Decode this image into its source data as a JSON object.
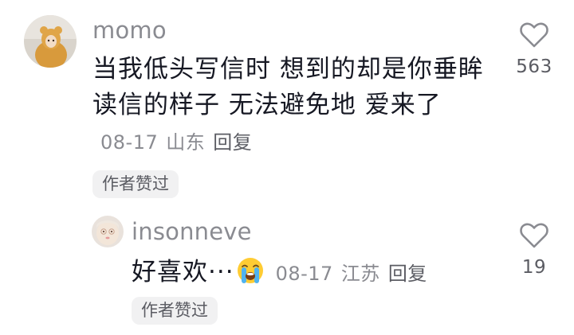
{
  "comments": [
    {
      "username": "momo",
      "text": "当我低头写信时 想到的却是你垂眸读信的样子 无法避免地 爱来了",
      "date": "08-17",
      "location": "山东",
      "reply_label": "回复",
      "author_tag": "作者赞过",
      "like_count": "563"
    }
  ],
  "replies": [
    {
      "username": "insonneve",
      "text": "好喜欢···",
      "emoji": "loudly-crying-face",
      "date": "08-17",
      "location": "江苏",
      "reply_label": "回复",
      "author_tag": "作者赞过",
      "like_count": "19"
    }
  ],
  "colors": {
    "secondary_text": "#8a8b91",
    "primary_text": "#161823",
    "tag_background": "#f1f1f2",
    "heart_outline": "#8a8b91"
  },
  "icons": {
    "like": "heart-outline-icon"
  }
}
